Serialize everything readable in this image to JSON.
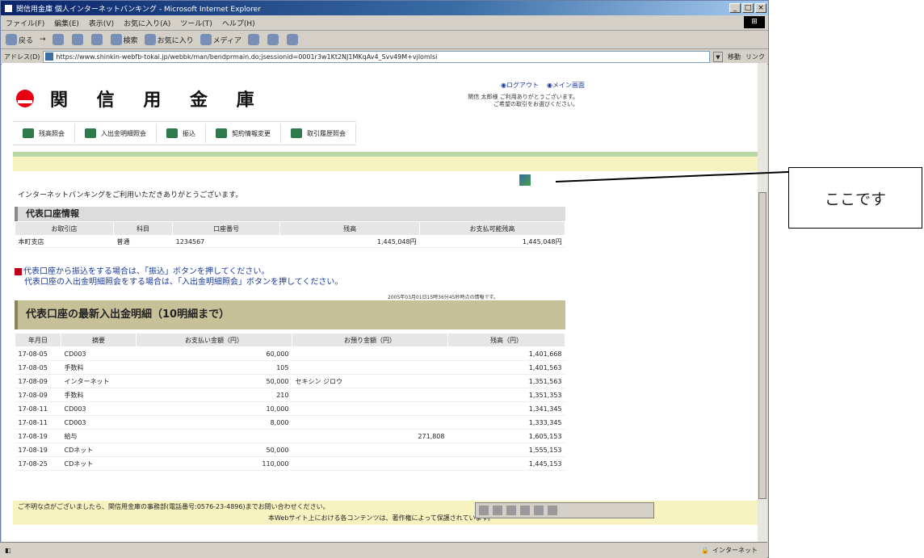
{
  "window": {
    "title": "関信用金庫 個人インターネットバンキング - Microsoft Internet Explorer",
    "buttons": [
      "_",
      "□",
      "×"
    ]
  },
  "menu": [
    "ファイル(F)",
    "編集(E)",
    "表示(V)",
    "お気に入り(A)",
    "ツール(T)",
    "ヘルプ(H)"
  ],
  "toolbar": [
    "戻る",
    "→",
    "検索",
    "お気に入り",
    "メディア"
  ],
  "address": {
    "label": "アドレス(D)",
    "url": "https://www.shinkin-webfb-tokai.jp/webbk/man/bendprmain.do;jsessionid=0001r3w1Kt2NJ1MKqAv4_Svv49M+vjlomlsi",
    "go": "移動",
    "links": "リンク"
  },
  "header": {
    "bank_name": "関 信 用 金 庫",
    "logout": "◉ログアウト",
    "main_menu": "◉メイン画面",
    "welcome_1": "関信 太郎様 ご利用ありがとうございます。",
    "welcome_2": "ご希望の取引をお選びください。"
  },
  "nav": [
    {
      "label": "残高照会",
      "icon": "coin-icon"
    },
    {
      "label": "入出金明細照会",
      "icon": "transfer-arrows-icon"
    },
    {
      "label": "振込",
      "icon": "money-transfer-icon"
    },
    {
      "label": "契約情報変更",
      "icon": "user-settings-icon"
    },
    {
      "label": "取引履歴照会",
      "icon": "history-list-icon"
    }
  ],
  "thanks": "インターネットバンキングをご利用いただきありがとうございます。",
  "representative": {
    "title": "代表口座情報",
    "headers": [
      "お取引店",
      "科目",
      "口座番号",
      "残高",
      "お支払可能残高"
    ],
    "row": [
      "本町支店",
      "普通",
      "1234567",
      "1,445,048円",
      "1,445,048円"
    ]
  },
  "notice": {
    "line1": "代表口座から振込をする場合は、「振込」ボタンを押してください。",
    "line2": "代表口座の入出金明細照会をする場合は、「入出金明細照会」ボタンを押してください。"
  },
  "as_of": "2005年03月01日15時36分45秒時点の情報です。",
  "recent": {
    "title": "代表口座の最新入出金明細（10明細まで）",
    "headers": [
      "年月日",
      "摘要",
      "お支払い金額（円）",
      "お預り金額（円）",
      "残高（円）"
    ],
    "rows": [
      [
        "17-08-05",
        "CD003",
        "60,000",
        "",
        "1,401,668"
      ],
      [
        "17-08-05",
        "手数料",
        "105",
        "",
        "1,401,563"
      ],
      [
        "17-08-09",
        "インターネット",
        "50,000",
        "セキシン ジロウ",
        "1,351,563"
      ],
      [
        "17-08-09",
        "手数料",
        "210",
        "",
        "1,351,353"
      ],
      [
        "17-08-11",
        "CD003",
        "10,000",
        "",
        "1,341,345"
      ],
      [
        "17-08-11",
        "CD003",
        "8,000",
        "",
        "1,333,345"
      ],
      [
        "17-08-19",
        "給与",
        "",
        "271,808",
        "1,605,153"
      ],
      [
        "17-08-19",
        "CDネット",
        "50,000",
        "",
        "1,555,153"
      ],
      [
        "17-08-25",
        "CDネット",
        "110,000",
        "",
        "1,445,153"
      ]
    ]
  },
  "footer": {
    "line1": "ご不明な点がございましたら、関信用金庫の事務部(電話番号:0576-23-4896)までお問い合わせください。",
    "line2": "本Webサイト上における各コンテンツは、著作権によって保護されています。"
  },
  "status": {
    "zone": "インターネット"
  },
  "callout": {
    "text": "ここです"
  }
}
